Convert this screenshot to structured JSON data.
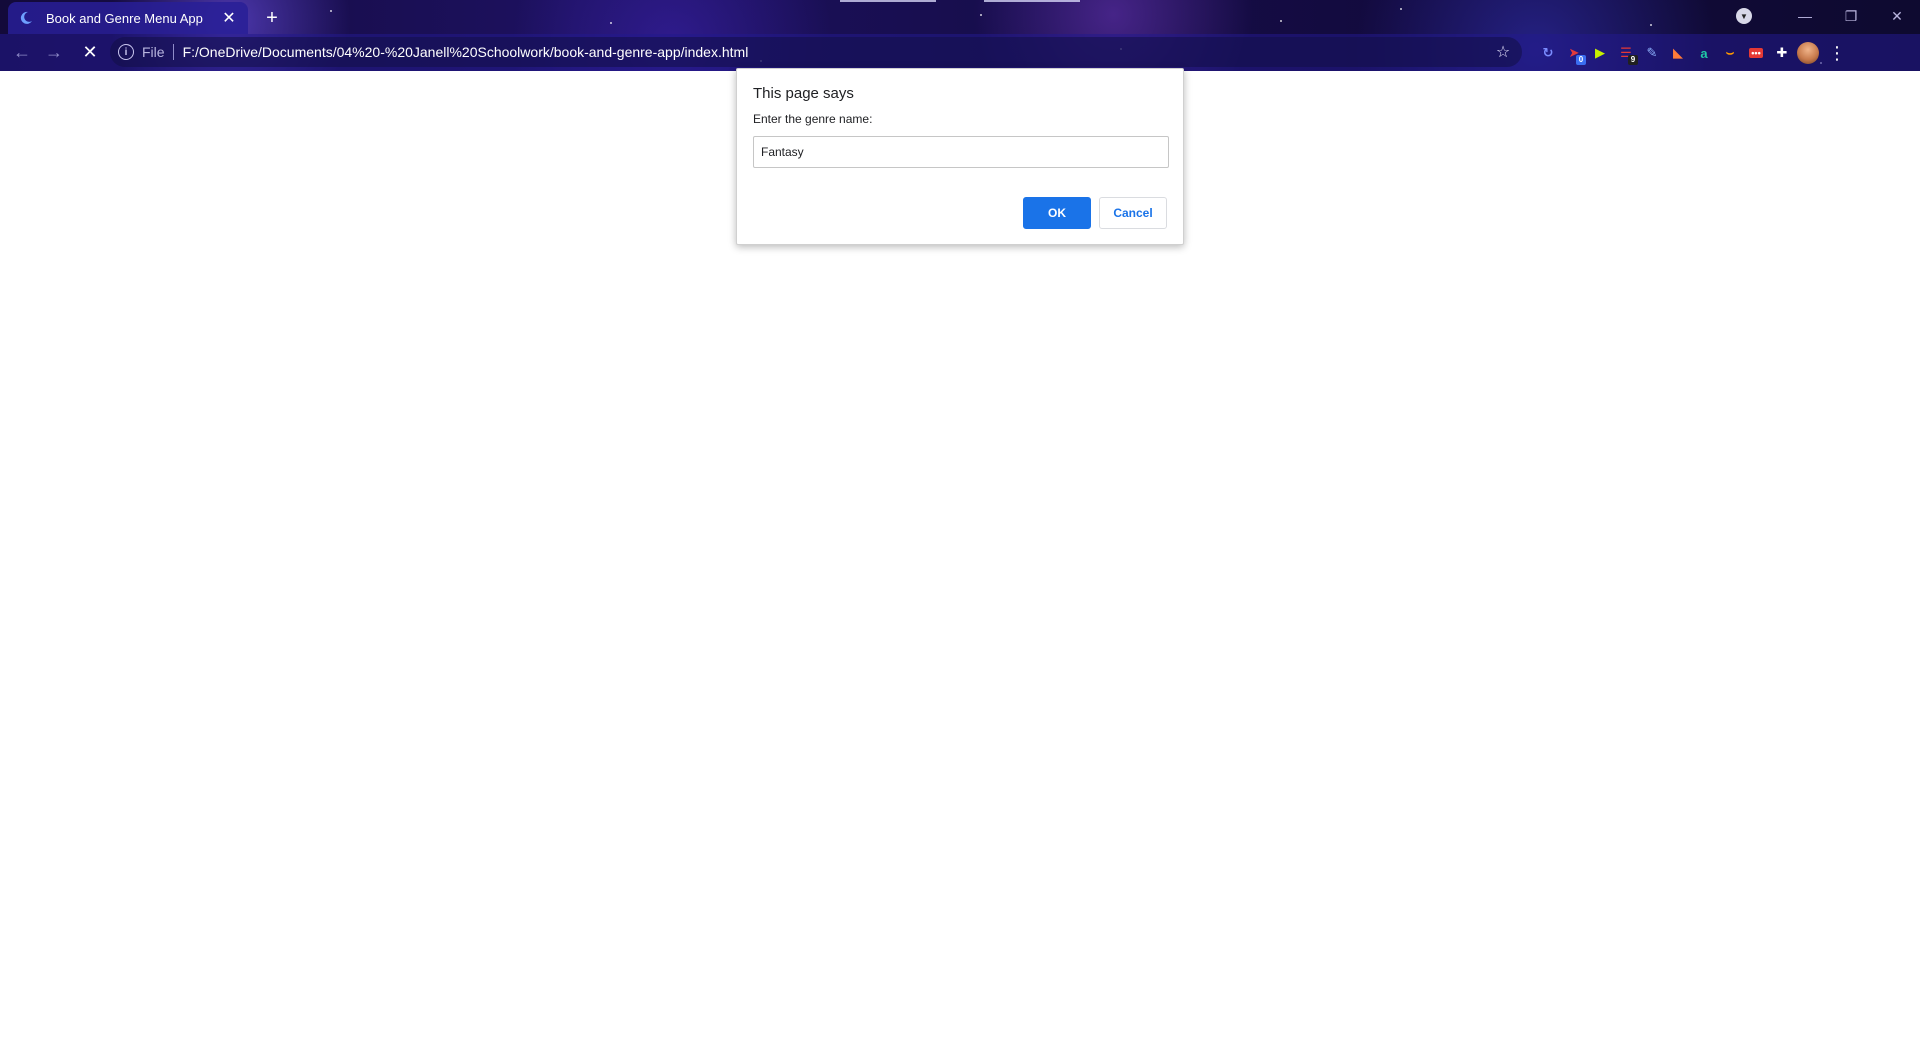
{
  "browser": {
    "tab": {
      "title": "Book and Genre Menu App",
      "favicon": "moon-icon",
      "close_label": "✕"
    },
    "new_tab_label": "+",
    "window_controls": {
      "minimize": "—",
      "restore": "❐",
      "close": "✕"
    },
    "nav": {
      "back": "←",
      "forward": "→",
      "stop": "✕"
    },
    "omnibox": {
      "scheme": "File",
      "url": "F:/OneDrive/Documents/04%20-%20Janell%20Schoolwork/book-and-genre-app/index.html"
    },
    "extensions": [
      {
        "name": "sync-extension-icon",
        "glyph": "↻",
        "color": "#7b8cff",
        "badge": ""
      },
      {
        "name": "bookmark-extension-icon",
        "glyph": "➤",
        "color": "#e33b3b",
        "badge": "0",
        "badge_color": "#3a6df0"
      },
      {
        "name": "play-extension-icon",
        "glyph": "▶",
        "color": "#c7f000",
        "badge": ""
      },
      {
        "name": "stack-extension-icon",
        "glyph": "☰",
        "color": "#e53935",
        "badge": "9",
        "badge_color": "#202020"
      },
      {
        "name": "pen-extension-icon",
        "glyph": "✎",
        "color": "#8fb4ff",
        "badge": "",
        "badge_color": "#3a6df0"
      },
      {
        "name": "vs-extension-icon",
        "glyph": "◣",
        "color": "#ff7b39",
        "badge": ""
      },
      {
        "name": "a-extension-icon",
        "glyph": "a",
        "color": "#20c9a6",
        "badge": ""
      },
      {
        "name": "amazon-extension-icon",
        "glyph": "⌣",
        "color": "#ff9900",
        "badge": ""
      },
      {
        "name": "dots-extension-icon",
        "glyph": "•••",
        "color": "#e53935",
        "badge": ""
      },
      {
        "name": "puzzle-extension-icon",
        "glyph": "✚",
        "color": "#ffffff",
        "badge": ""
      }
    ]
  },
  "dialog": {
    "title": "This page says",
    "message": "Enter the genre name:",
    "input_value": "Fantasy",
    "ok_label": "OK",
    "cancel_label": "Cancel"
  },
  "colors": {
    "primary_button": "#1a73e8",
    "chrome_background": "#1d1160"
  }
}
